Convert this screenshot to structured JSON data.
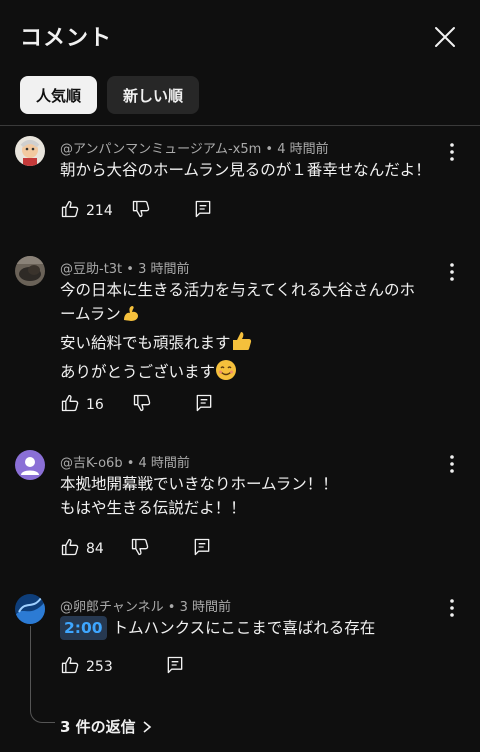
{
  "header": {
    "title": "コメント",
    "close_icon": "close-icon"
  },
  "sort": {
    "chips": [
      {
        "label": "人気順",
        "active": true
      },
      {
        "label": "新しい順",
        "active": false
      }
    ]
  },
  "comments": [
    {
      "author": "@アンパンマンミュージアム-x5m",
      "time": "4 時間前",
      "lines": [
        "朝から大谷のホームラン見るのが１番幸せなんだよ！"
      ],
      "likes": "214"
    },
    {
      "author": "@豆助-t3t",
      "time": "3 時間前",
      "lines": [
        "今の日本に生きる活力を与えてくれる大谷さんのホ",
        "ームラン",
        "安い給料でも頑張れます",
        "ありがとうございます"
      ],
      "likes": "16"
    },
    {
      "author": "@吉K-o6b",
      "time": "4 時間前",
      "lines": [
        "本拠地開幕戦でいきなりホームラン！！",
        "もはや生きる伝説だよ！！"
      ],
      "likes": "84"
    },
    {
      "author": "@卵郎チャンネル",
      "time": "3 時間前",
      "timestamp_link": "2:00",
      "lines": [
        "トムハンクスにここまで喜ばれる存在"
      ],
      "likes": "253"
    }
  ],
  "replies_link": "3 件の返信",
  "colors": {
    "background": "#0f0f0f",
    "text": "#f1f1f1",
    "meta": "#aaaaaa",
    "link": "#3ea6ff",
    "avatar_purple": "#8a6fd6"
  },
  "icons": [
    "like-icon",
    "dislike-icon",
    "reply-icon",
    "more-vert-icon",
    "chevron-right-icon"
  ]
}
